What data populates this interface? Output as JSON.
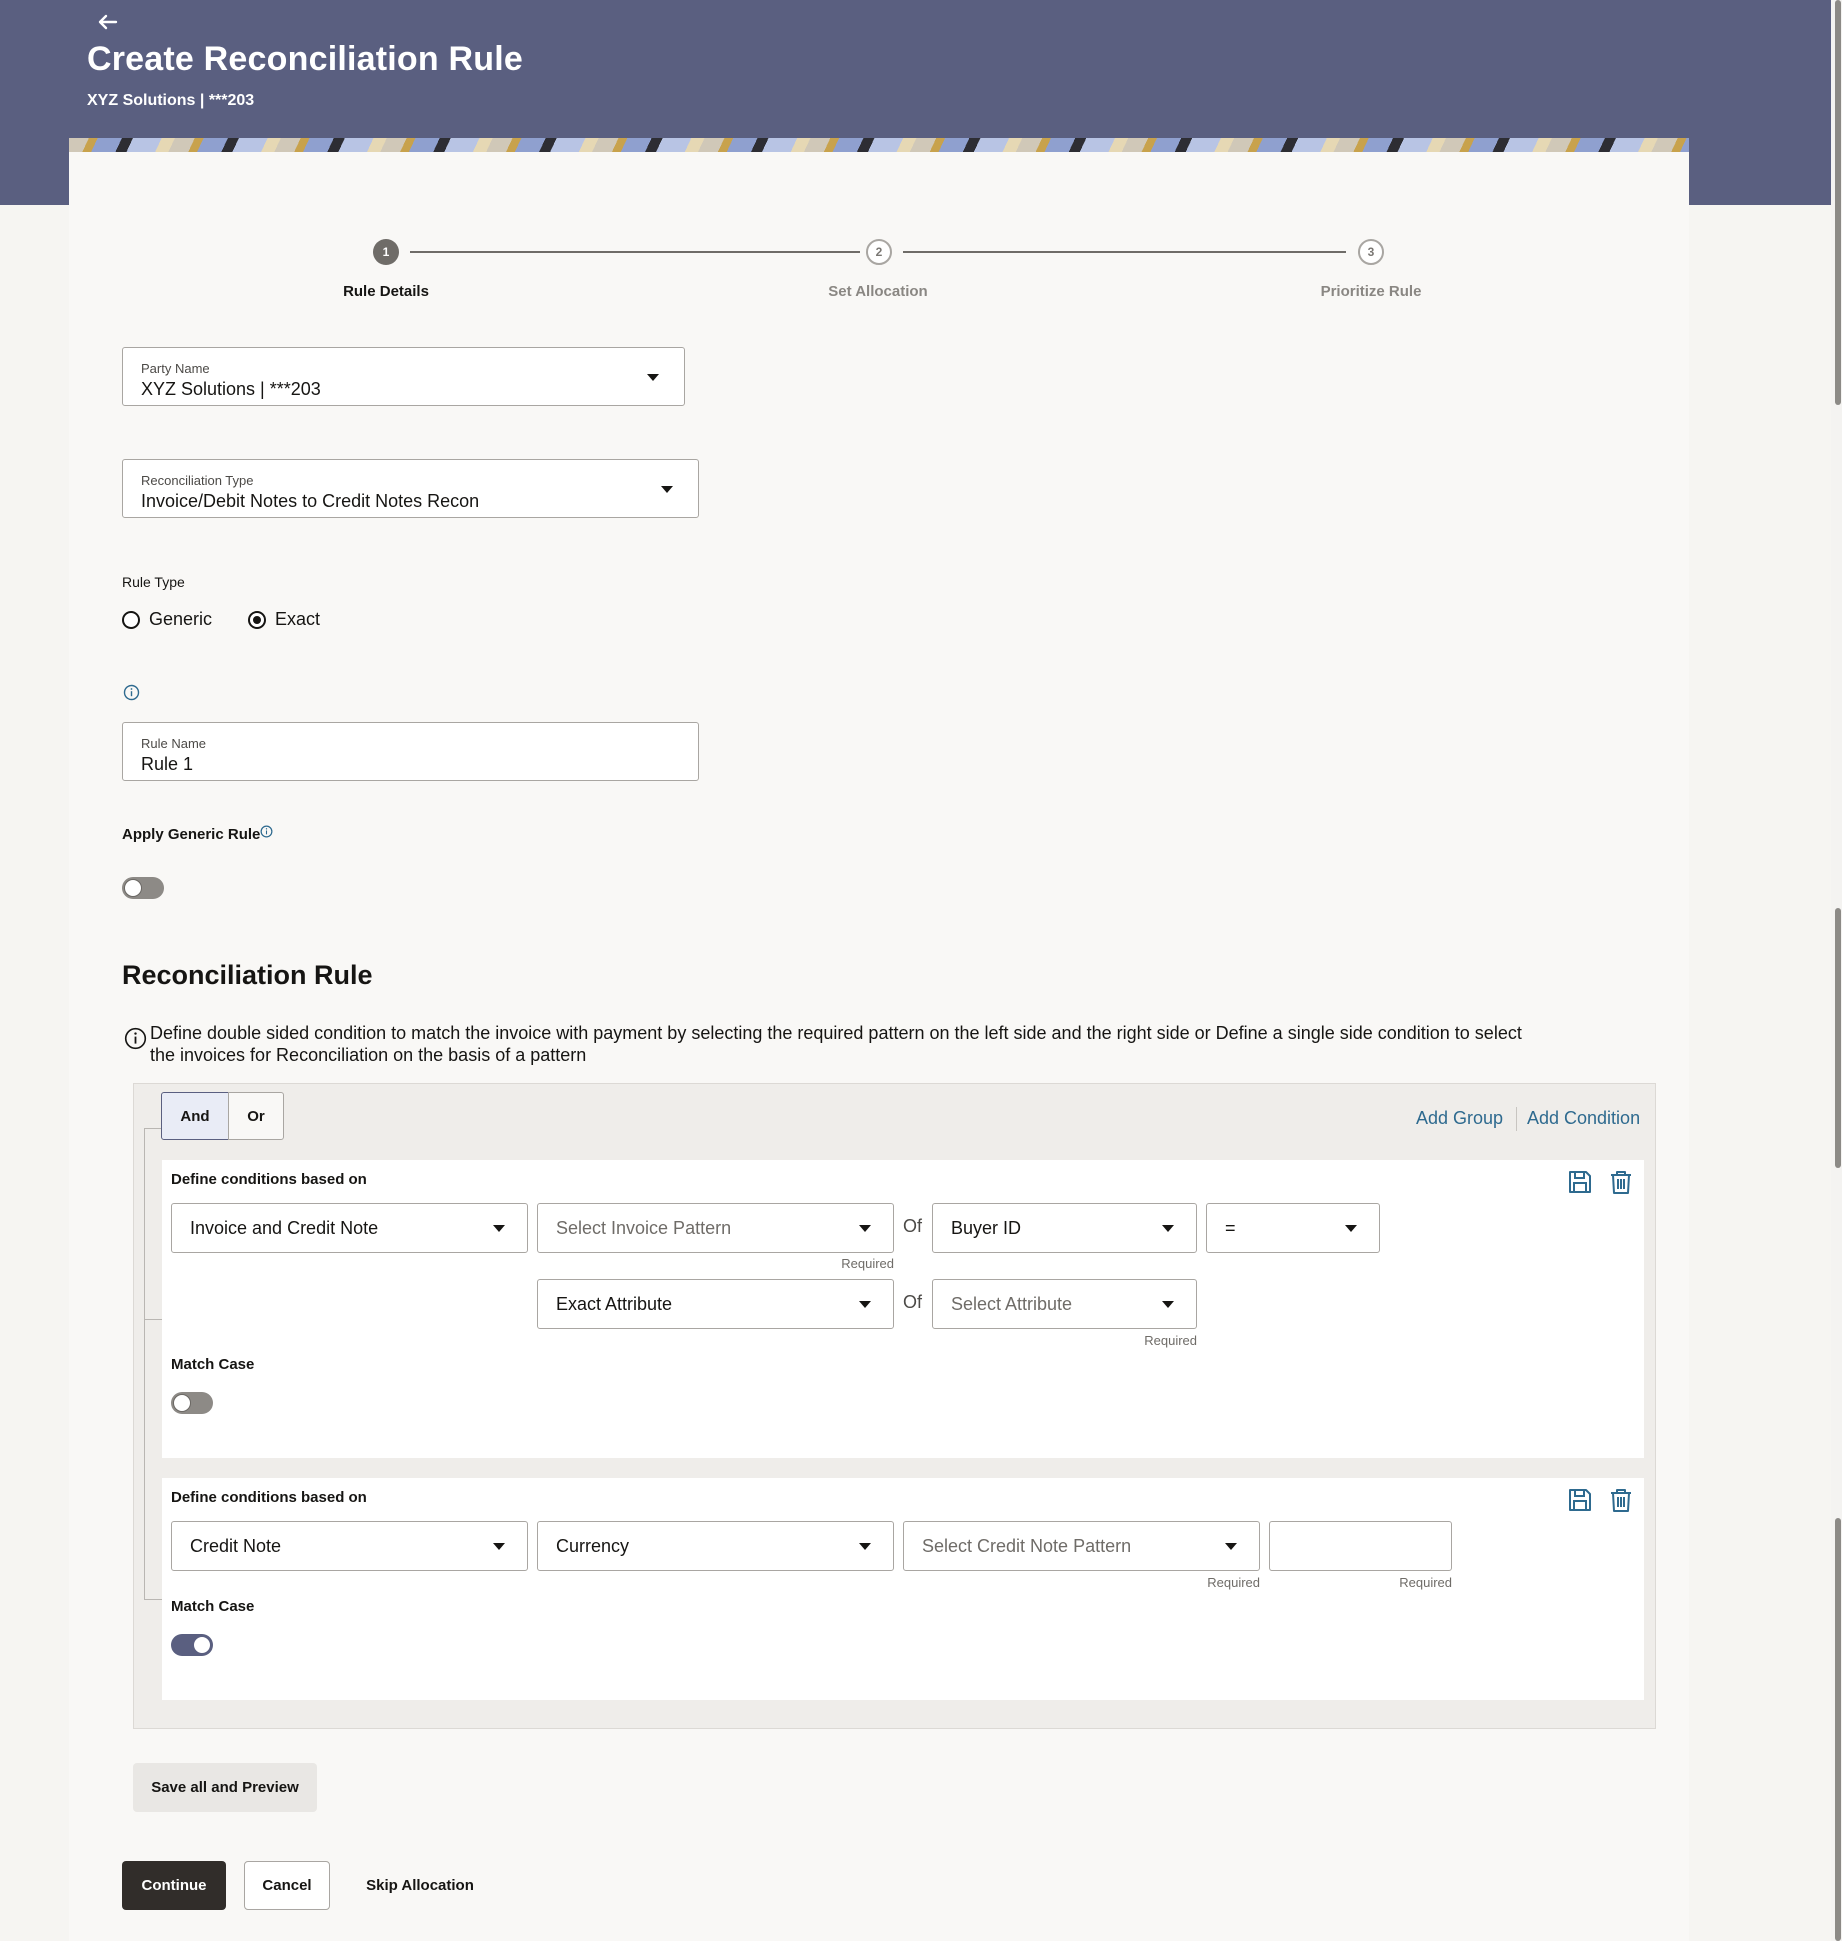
{
  "header": {
    "title": "Create Reconciliation Rule",
    "subtitle": "XYZ Solutions | ***203"
  },
  "stepper": [
    {
      "number": "1",
      "label": "Rule Details",
      "state": "active"
    },
    {
      "number": "2",
      "label": "Set Allocation",
      "state": "inactive"
    },
    {
      "number": "3",
      "label": "Prioritize Rule",
      "state": "inactive"
    }
  ],
  "form": {
    "party_name": {
      "label": "Party Name",
      "value": "XYZ Solutions | ***203"
    },
    "reconciliation_type": {
      "label": "Reconciliation Type",
      "value": "Invoice/Debit Notes to Credit Notes Recon"
    },
    "rule_type": {
      "label": "Rule Type",
      "options": [
        {
          "label": "Generic",
          "checked": false
        },
        {
          "label": "Exact",
          "checked": true
        }
      ]
    },
    "rule_name": {
      "label": "Rule Name",
      "value": "Rule 1"
    },
    "apply_generic_rule": {
      "label": "Apply Generic Rule",
      "on": false
    }
  },
  "reconciliation_rule": {
    "title": "Reconciliation Rule",
    "description": "Define double sided condition to match the invoice with payment by selecting the required pattern on the left side and the right side or Define a single side condition to select the invoices for Reconciliation on the basis of a pattern",
    "logic": {
      "and_label": "And",
      "or_label": "Or",
      "selected": "And"
    },
    "add_group_label": "Add Group",
    "add_condition_label": "Add Condition",
    "conditions": [
      {
        "title": "Define conditions based on",
        "row1": {
          "basis": "Invoice and Credit Note",
          "pattern_placeholder": "Select Invoice Pattern",
          "pattern_required": "Required",
          "of": "Of",
          "attribute": "Buyer ID",
          "operator": "="
        },
        "row2": {
          "exact": "Exact Attribute",
          "of": "Of",
          "attribute_placeholder": "Select Attribute",
          "attribute_required": "Required"
        },
        "match_case_label": "Match Case",
        "match_case_on": false
      },
      {
        "title": "Define conditions based on",
        "row1": {
          "basis": "Credit Note",
          "field": "Currency",
          "pattern_placeholder": "Select Credit Note Pattern",
          "pattern_required": "Required",
          "value": "",
          "value_required": "Required"
        },
        "match_case_label": "Match Case",
        "match_case_on": true
      }
    ]
  },
  "actions": {
    "save_preview": "Save all and Preview",
    "continue": "Continue",
    "cancel": "Cancel",
    "skip": "Skip Allocation"
  },
  "icons": {
    "back": "back-arrow-icon",
    "info": "info-icon",
    "save": "save-icon",
    "delete": "trash-icon"
  },
  "colors": {
    "header_bg": "#5a5f80",
    "link": "#2e6a8f",
    "primary_button": "#312d2a",
    "toggle_on": "#5a5f80"
  }
}
